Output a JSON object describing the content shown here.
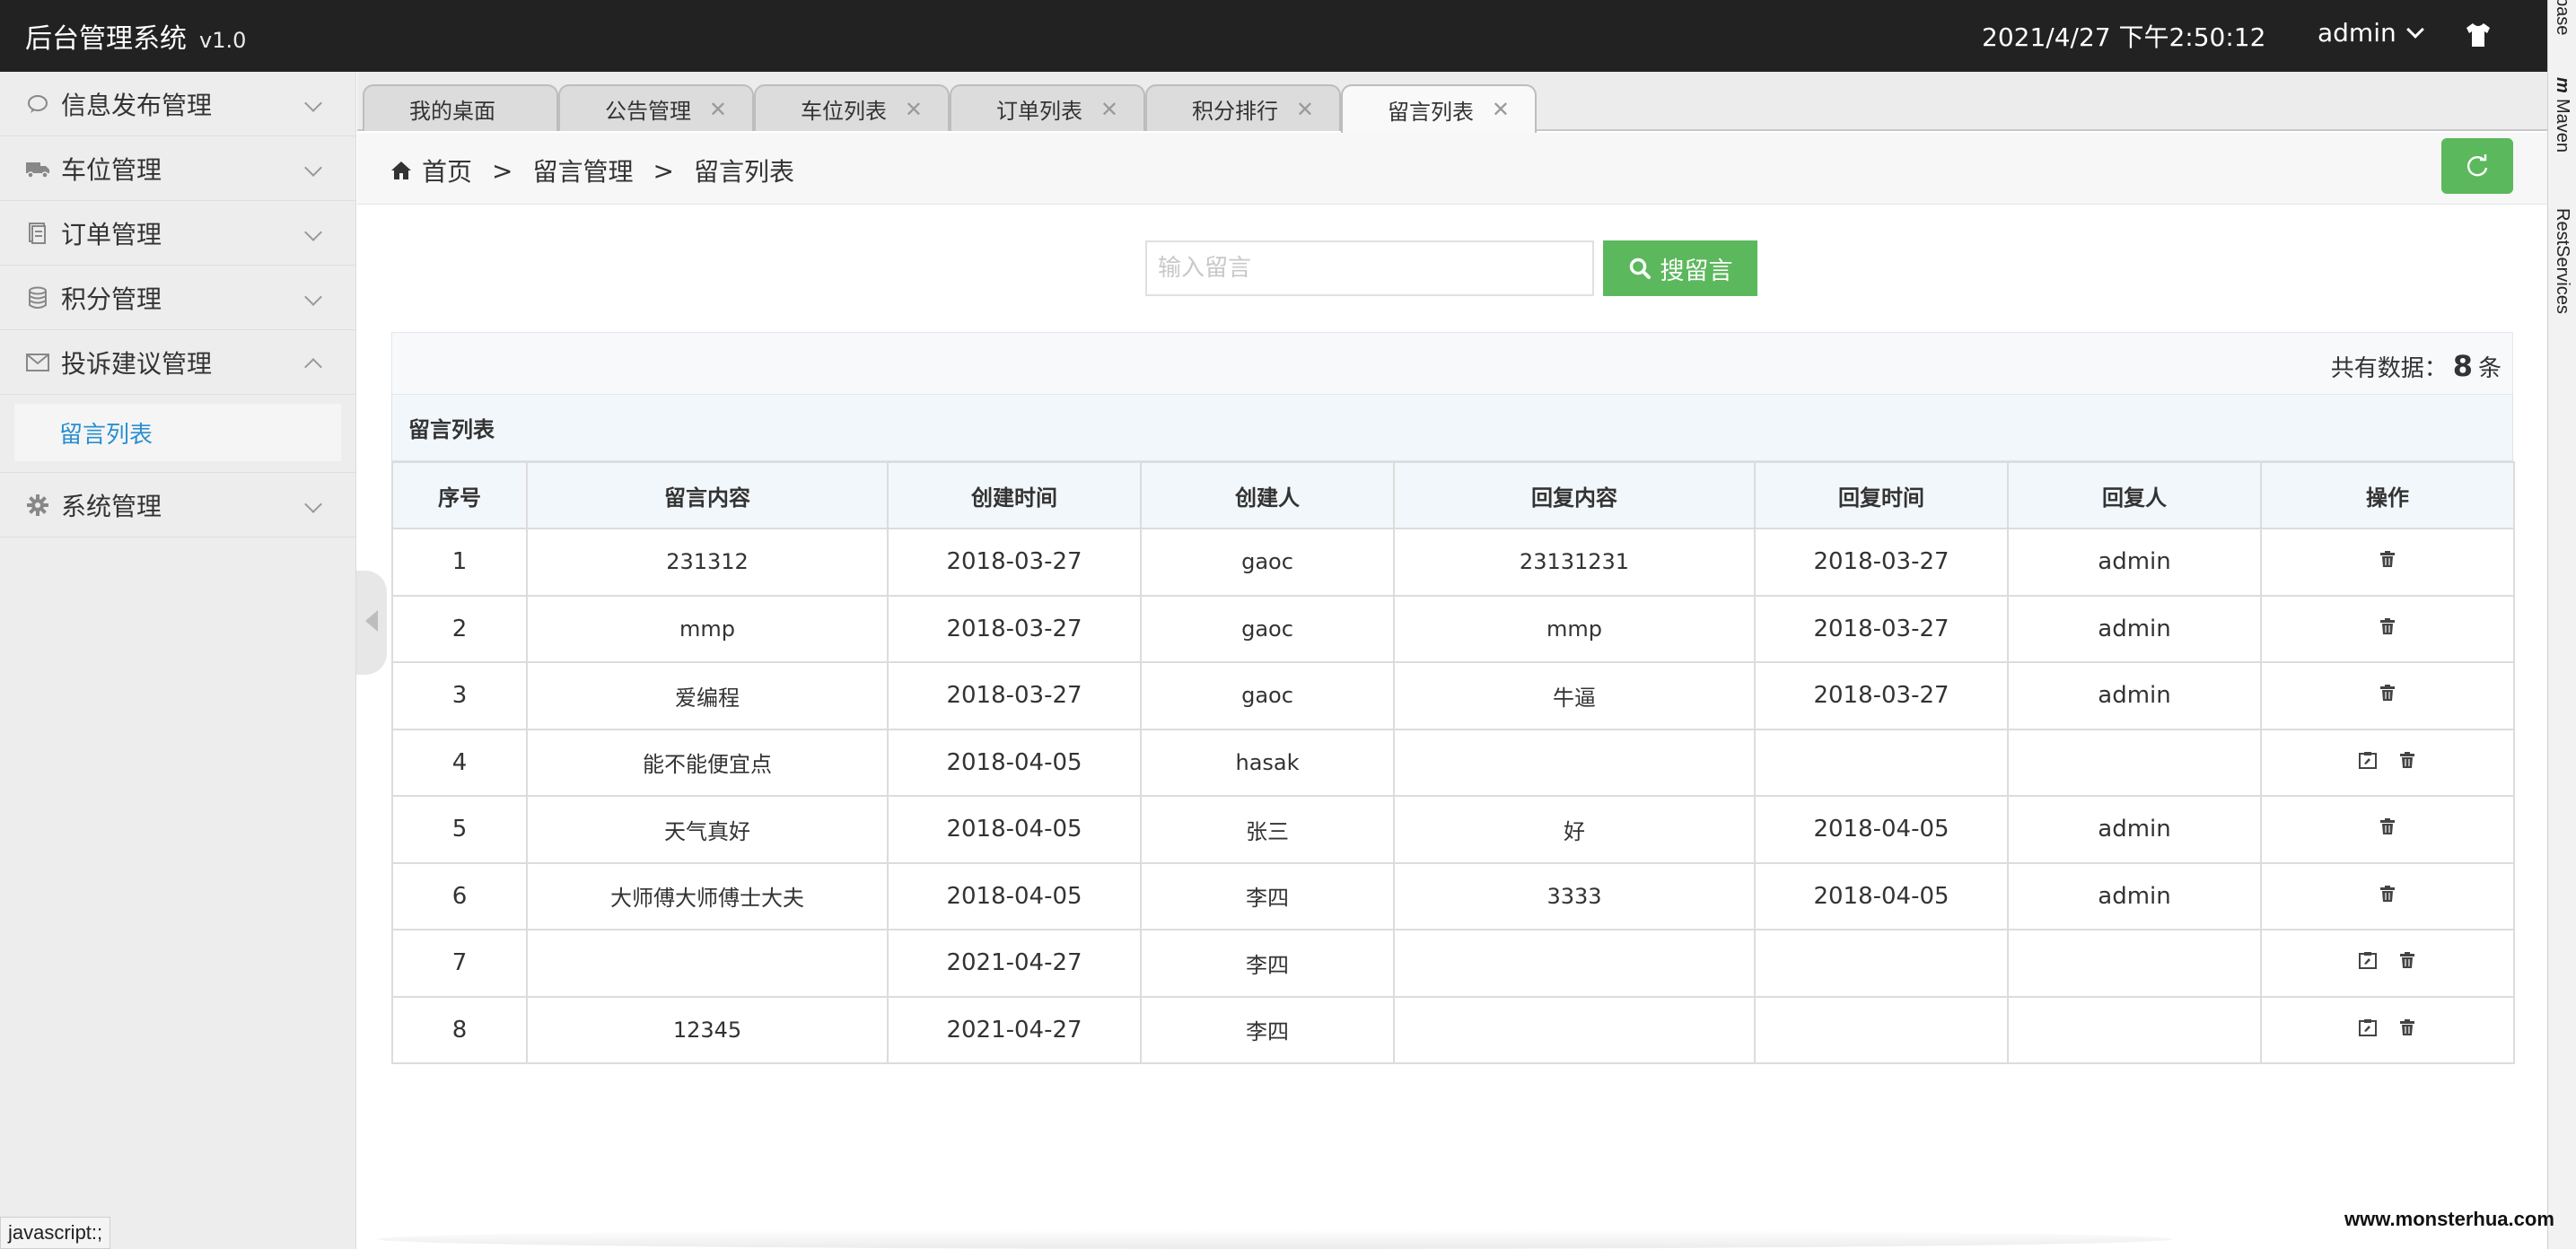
{
  "header": {
    "app_title": "后台管理系统",
    "version": "v1.0",
    "datetime": "2021/4/27 下午2:50:12",
    "user": "admin",
    "skin_icon": "tshirt-icon"
  },
  "ide_strip": {
    "labels": [
      "base",
      "m",
      "Maven",
      "RestServices"
    ]
  },
  "sidebar": {
    "items": [
      {
        "label": "信息发布管理",
        "icon": "comment-icon"
      },
      {
        "label": "车位管理",
        "icon": "truck-icon"
      },
      {
        "label": "订单管理",
        "icon": "document-icon"
      },
      {
        "label": "积分管理",
        "icon": "database-icon"
      },
      {
        "label": "投诉建议管理",
        "icon": "envelope-icon"
      },
      {
        "label": "系统管理",
        "icon": "gear-icon"
      }
    ],
    "active_sub": "留言列表"
  },
  "tabs": [
    {
      "label": "我的桌面"
    },
    {
      "label": "公告管理"
    },
    {
      "label": "车位列表"
    },
    {
      "label": "订单列表"
    },
    {
      "label": "积分排行"
    },
    {
      "label": "留言列表"
    }
  ],
  "breadcrumb": {
    "home": "首页",
    "level1": "留言管理",
    "level2": "留言列表",
    "sep": ">"
  },
  "search": {
    "placeholder": "输入留言",
    "value": "",
    "button_label": "搜留言"
  },
  "summary": {
    "prefix": "共有数据：",
    "count": "8",
    "suffix": "条"
  },
  "table": {
    "caption": "留言列表",
    "columns": [
      "序号",
      "留言内容",
      "创建时间",
      "创建人",
      "回复内容",
      "回复时间",
      "回复人",
      "操作"
    ],
    "rows": [
      {
        "id": "1",
        "content": "231312",
        "created": "2018-03-27",
        "creator": "gaoc",
        "reply": "23131231",
        "reply_time": "2018-03-27",
        "replier": "admin",
        "ops": [
          "delete"
        ]
      },
      {
        "id": "2",
        "content": "mmp",
        "created": "2018-03-27",
        "creator": "gaoc",
        "reply": "mmp",
        "reply_time": "2018-03-27",
        "replier": "admin",
        "ops": [
          "delete"
        ]
      },
      {
        "id": "3",
        "content": "爱编程",
        "created": "2018-03-27",
        "creator": "gaoc",
        "reply": "牛逼",
        "reply_time": "2018-03-27",
        "replier": "admin",
        "ops": [
          "delete"
        ]
      },
      {
        "id": "4",
        "content": "能不能便宜点",
        "created": "2018-04-05",
        "creator": "hasak",
        "reply": "",
        "reply_time": "",
        "replier": "",
        "ops": [
          "reply",
          "delete"
        ]
      },
      {
        "id": "5",
        "content": "天气真好",
        "created": "2018-04-05",
        "creator": "张三",
        "reply": "好",
        "reply_time": "2018-04-05",
        "replier": "admin",
        "ops": [
          "delete"
        ]
      },
      {
        "id": "6",
        "content": "大师傅大师傅士大夫",
        "created": "2018-04-05",
        "creator": "李四",
        "reply": "3333",
        "reply_time": "2018-04-05",
        "replier": "admin",
        "ops": [
          "delete"
        ]
      },
      {
        "id": "7",
        "content": "",
        "created": "2021-04-27",
        "creator": "李四",
        "reply": "",
        "reply_time": "",
        "replier": "",
        "ops": [
          "reply",
          "delete"
        ]
      },
      {
        "id": "8",
        "content": "12345",
        "created": "2021-04-27",
        "creator": "李四",
        "reply": "",
        "reply_time": "",
        "replier": "",
        "ops": [
          "reply",
          "delete"
        ]
      }
    ]
  },
  "status_bar": "javascript:;",
  "watermark": "www.monsterhua.com",
  "colors": {
    "header_bg": "#222222",
    "accent_green": "#5cb85c",
    "active_link": "#2a8fd0"
  }
}
